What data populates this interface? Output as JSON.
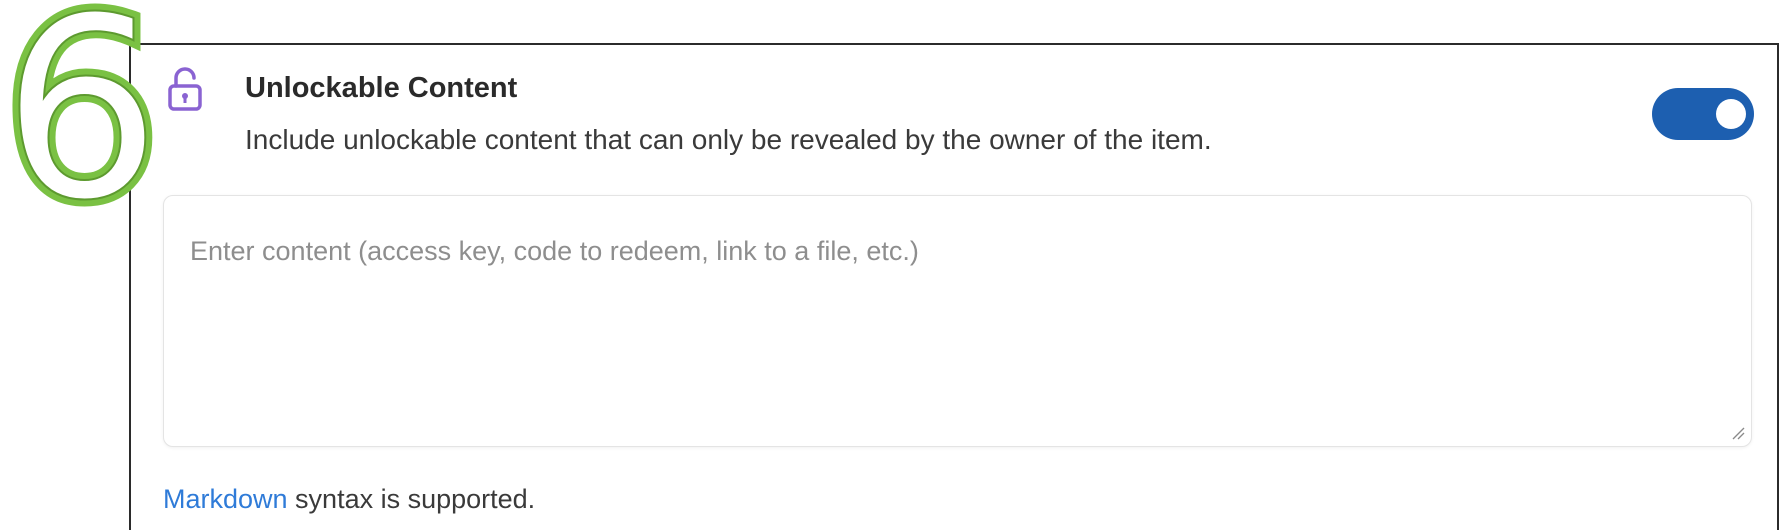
{
  "annotation": {
    "step_number": "6",
    "color": "#7ac143"
  },
  "section": {
    "icon": "unlock-icon",
    "icon_color": "#8a63d2",
    "title": "Unlockable Content",
    "description": "Include unlockable content that can only be revealed by the owner of the item."
  },
  "toggle": {
    "state": "on",
    "color": "#1d5fb0"
  },
  "content_field": {
    "placeholder": "Enter content (access key, code to redeem, link to a file, etc.)",
    "value": ""
  },
  "footer": {
    "link_text": "Markdown",
    "link_color": "#2f7bd8",
    "text": " syntax is supported."
  }
}
